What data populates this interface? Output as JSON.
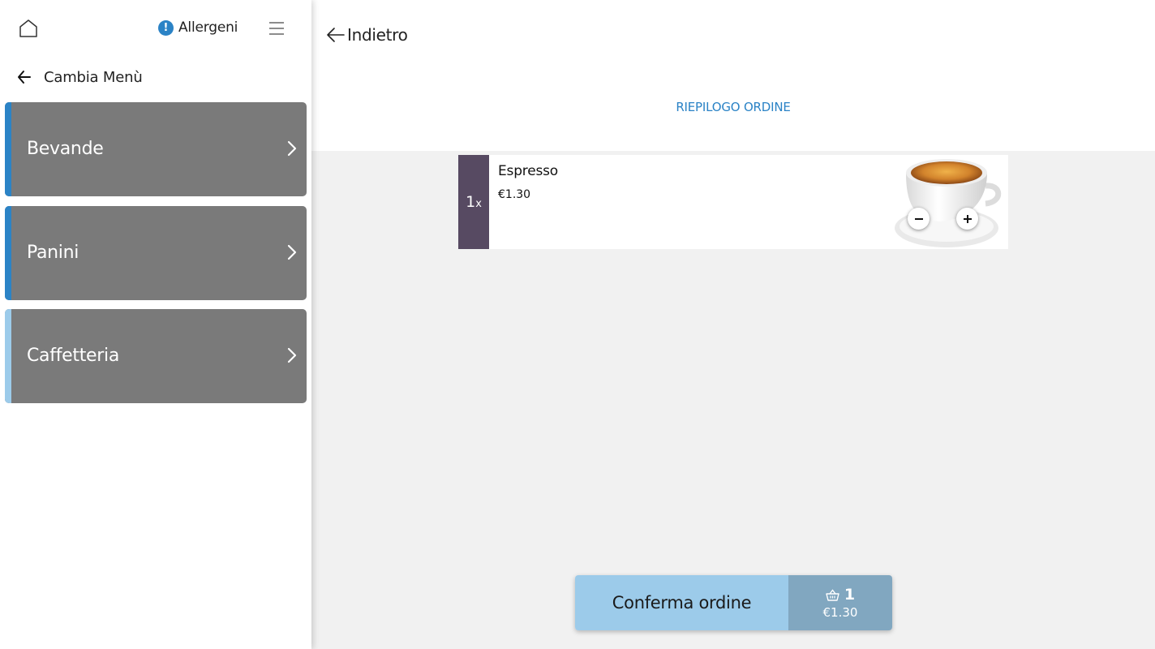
{
  "sidebar": {
    "home_icon": "home-icon",
    "allergens": {
      "icon": "info-alert-icon",
      "icon_glyph": "!",
      "label": "Allergeni",
      "icon_color": "#2b83c6"
    },
    "menu_icon": "hamburger-menu-icon",
    "change_menu": {
      "icon": "arrow-left-icon",
      "label": "Cambia Menù"
    },
    "categories": [
      {
        "label": "Bevande",
        "accent": "#2b83c6"
      },
      {
        "label": "Panini",
        "accent": "#2b83c6"
      },
      {
        "label": "Caffetteria",
        "accent": "#9ccbea"
      }
    ]
  },
  "header": {
    "back_label": "Indietro",
    "title": "RIEPILOGO ORDINE"
  },
  "order": {
    "items": [
      {
        "quantity": "1",
        "quantity_suffix": "x",
        "name": "Espresso",
        "price": "€1.30",
        "image": "espresso-cup-image"
      }
    ]
  },
  "footer": {
    "confirm_label": "Conferma ordine",
    "cart_icon": "basket-icon",
    "cart_count": "1",
    "cart_total": "€1.30"
  },
  "colors": {
    "accent": "#2b83c6",
    "category_bg": "#7a7a7a",
    "quantity_bg": "#574a62",
    "confirm_bg": "#9ccbea",
    "cart_bg": "#81a7c0"
  }
}
